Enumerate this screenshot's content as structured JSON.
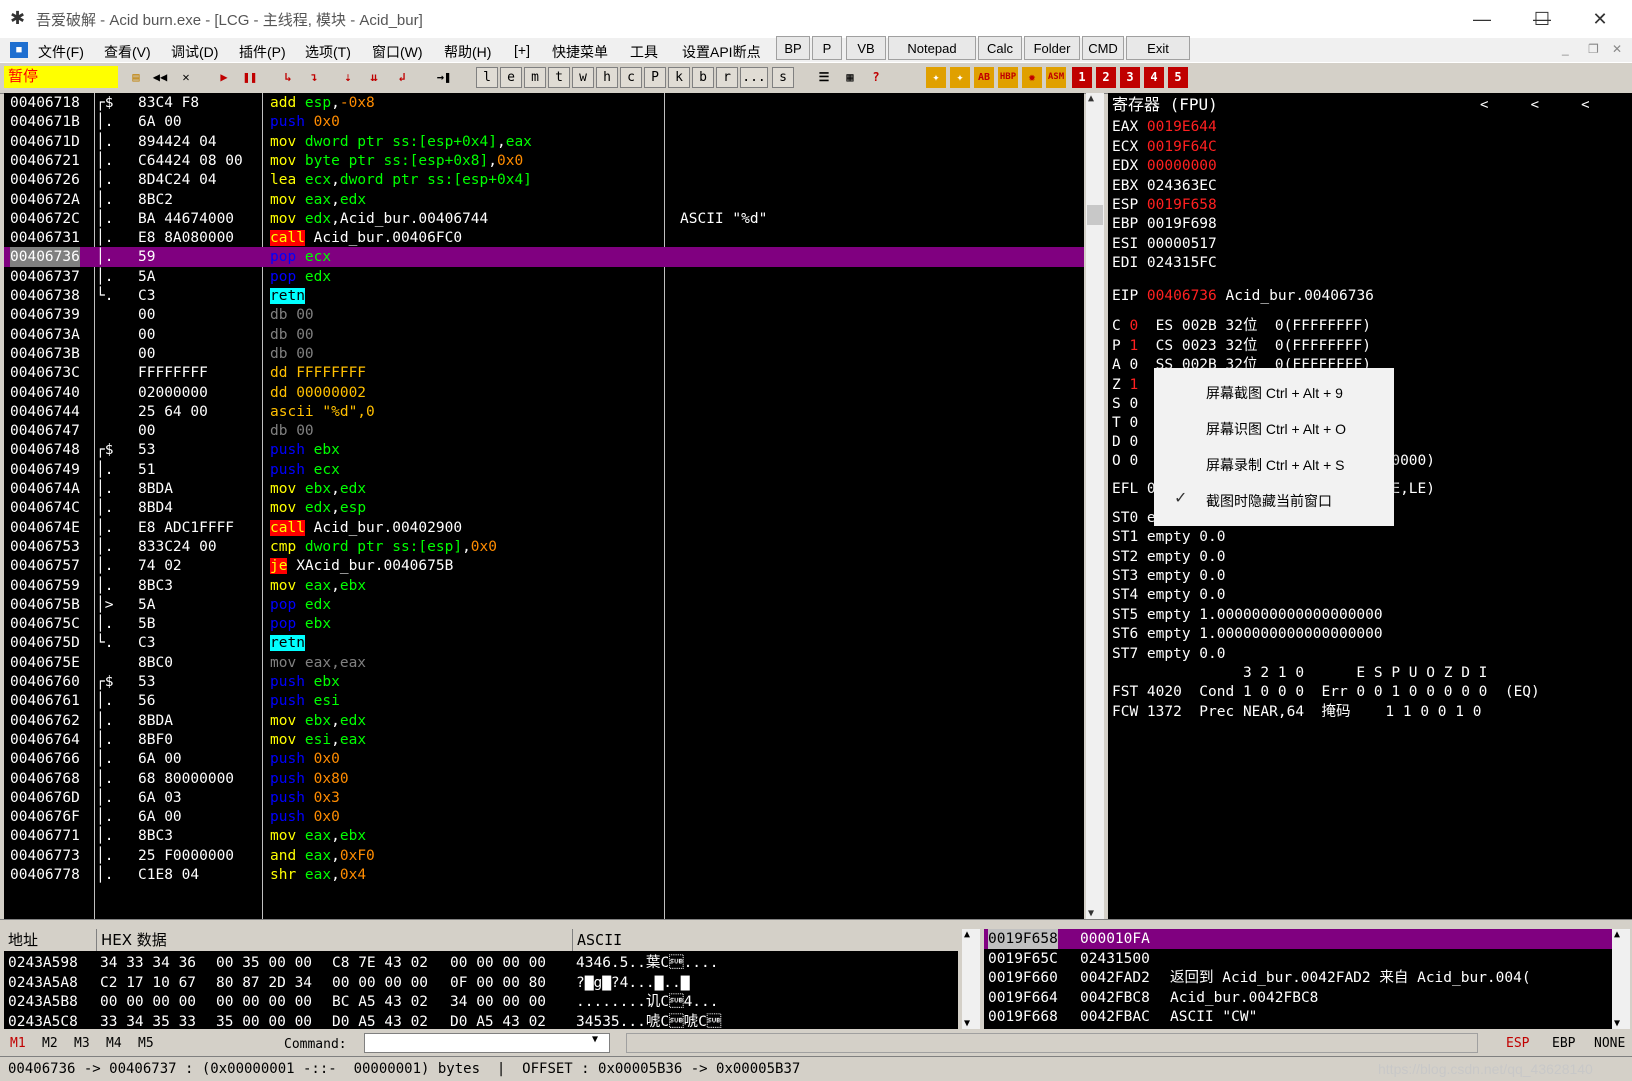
{
  "window": {
    "title": "吾爱破解 - Acid burn.exe - [LCG - 主线程, 模块 - Acid_bur]",
    "min": "—",
    "max": "☐",
    "close": "✕"
  },
  "menu": {
    "items": [
      "文件(F)",
      "查看(V)",
      "调试(D)",
      "插件(P)",
      "选项(T)",
      "窗口(W)",
      "帮助(H)",
      "[+]",
      "快捷菜单",
      "工具",
      "设置API断点"
    ],
    "buttons": [
      "BP",
      "P",
      "VB",
      "Notepad",
      "Calc",
      "Folder",
      "CMD",
      "Exit"
    ]
  },
  "toolbar": {
    "status": "暂停",
    "letters": [
      "l",
      "e",
      "m",
      "t",
      "w",
      "h",
      "c",
      "P",
      "k",
      "b",
      "r",
      "...",
      "s"
    ],
    "nums": [
      "1",
      "2",
      "3",
      "4",
      "5"
    ]
  },
  "cpu_rows": [
    {
      "a": "00406718",
      "b": "┌$",
      "h": "83C4 F8",
      "d": [
        [
          "op",
          "add "
        ],
        [
          "reg",
          "esp"
        ],
        [
          "wht",
          ","
        ],
        [
          "num",
          "-0x8"
        ]
      ],
      "c": ""
    },
    {
      "a": "0040671B",
      "b": "│.",
      "h": "6A 00",
      "d": [
        [
          "push",
          "push "
        ],
        [
          "num",
          "0x0"
        ]
      ],
      "c": ""
    },
    {
      "a": "0040671D",
      "b": "│.",
      "h": "894424 04",
      "d": [
        [
          "op",
          "mov "
        ],
        [
          "reg",
          "dword ptr ss:[esp+0x4]"
        ],
        [
          "wht",
          ","
        ],
        [
          "reg",
          "eax"
        ]
      ],
      "c": ""
    },
    {
      "a": "00406721",
      "b": "│.",
      "h": "C64424 08 00",
      "d": [
        [
          "op",
          "mov "
        ],
        [
          "reg",
          "byte ptr ss:[esp+0x8]"
        ],
        [
          "wht",
          ","
        ],
        [
          "num",
          "0x0"
        ]
      ],
      "c": ""
    },
    {
      "a": "00406726",
      "b": "│.",
      "h": "8D4C24 04",
      "d": [
        [
          "op",
          "lea "
        ],
        [
          "reg",
          "ecx"
        ],
        [
          "wht",
          ","
        ],
        [
          "reg",
          "dword ptr ss:[esp+0x4]"
        ]
      ],
      "c": ""
    },
    {
      "a": "0040672A",
      "b": "│.",
      "h": "8BC2",
      "d": [
        [
          "op",
          "mov "
        ],
        [
          "reg",
          "eax"
        ],
        [
          "wht",
          ","
        ],
        [
          "reg",
          "edx"
        ]
      ],
      "c": ""
    },
    {
      "a": "0040672C",
      "b": "│.",
      "h": "BA 44674000",
      "d": [
        [
          "op",
          "mov "
        ],
        [
          "reg",
          "edx"
        ],
        [
          "wht",
          ",Acid_bur.00406744"
        ]
      ],
      "c": "ASCII \"%d\""
    },
    {
      "a": "00406731",
      "b": "│.",
      "h": "E8 8A080000",
      "d": [
        [
          "call",
          "call"
        ],
        [
          "wht",
          " Acid_bur.00406FC0"
        ]
      ],
      "c": ""
    },
    {
      "a": "00406736",
      "b": "│.",
      "h": "59",
      "d": [
        [
          "push",
          "pop "
        ],
        [
          "reg",
          "ecx"
        ]
      ],
      "c": "",
      "sel": true
    },
    {
      "a": "00406737",
      "b": "│.",
      "h": "5A",
      "d": [
        [
          "push",
          "pop "
        ],
        [
          "reg",
          "edx"
        ]
      ],
      "c": ""
    },
    {
      "a": "00406738",
      "b": "└.",
      "h": "C3",
      "d": [
        [
          "retn",
          "retn"
        ]
      ],
      "c": ""
    },
    {
      "a": "00406739",
      "b": "",
      "h": "00",
      "d": [
        [
          "dim",
          "db 00"
        ]
      ],
      "c": ""
    },
    {
      "a": "0040673A",
      "b": "",
      "h": "00",
      "d": [
        [
          "dim",
          "db 00"
        ]
      ],
      "c": ""
    },
    {
      "a": "0040673B",
      "b": "",
      "h": "00",
      "d": [
        [
          "dim",
          "db 00"
        ]
      ],
      "c": ""
    },
    {
      "a": "0040673C",
      "b": "",
      "h": "FFFFFFFF",
      "d": [
        [
          "data",
          "dd FFFFFFFF"
        ]
      ],
      "c": ""
    },
    {
      "a": "00406740",
      "b": "",
      "h": "02000000",
      "d": [
        [
          "data",
          "dd 00000002"
        ]
      ],
      "c": ""
    },
    {
      "a": "00406744",
      "b": "",
      "h": "25 64 00",
      "d": [
        [
          "data",
          "ascii \"%d\",0"
        ]
      ],
      "c": ""
    },
    {
      "a": "00406747",
      "b": "",
      "h": "00",
      "d": [
        [
          "dim",
          "db 00"
        ]
      ],
      "c": ""
    },
    {
      "a": "00406748",
      "b": "┌$",
      "h": "53",
      "d": [
        [
          "push",
          "push "
        ],
        [
          "reg",
          "ebx"
        ]
      ],
      "c": ""
    },
    {
      "a": "00406749",
      "b": "│.",
      "h": "51",
      "d": [
        [
          "push",
          "push "
        ],
        [
          "reg",
          "ecx"
        ]
      ],
      "c": ""
    },
    {
      "a": "0040674A",
      "b": "│.",
      "h": "8BDA",
      "d": [
        [
          "op",
          "mov "
        ],
        [
          "reg",
          "ebx"
        ],
        [
          "wht",
          ","
        ],
        [
          "reg",
          "edx"
        ]
      ],
      "c": ""
    },
    {
      "a": "0040674C",
      "b": "│.",
      "h": "8BD4",
      "d": [
        [
          "op",
          "mov "
        ],
        [
          "reg",
          "edx"
        ],
        [
          "wht",
          ","
        ],
        [
          "reg",
          "esp"
        ]
      ],
      "c": ""
    },
    {
      "a": "0040674E",
      "b": "│.",
      "h": "E8 ADC1FFFF",
      "d": [
        [
          "call",
          "call"
        ],
        [
          "wht",
          " Acid_bur.00402900"
        ]
      ],
      "c": ""
    },
    {
      "a": "00406753",
      "b": "│.",
      "h": "833C24 00",
      "d": [
        [
          "op",
          "cmp "
        ],
        [
          "reg",
          "dword ptr ss:[esp]"
        ],
        [
          "wht",
          ","
        ],
        [
          "num",
          "0x0"
        ]
      ],
      "c": ""
    },
    {
      "a": "00406757",
      "b": "│.",
      "h": "74 02",
      "d": [
        [
          "call",
          "je"
        ],
        [
          "wht",
          " XAcid_bur.0040675B"
        ]
      ],
      "c": ""
    },
    {
      "a": "00406759",
      "b": "│.",
      "h": "8BC3",
      "d": [
        [
          "op",
          "mov "
        ],
        [
          "reg",
          "eax"
        ],
        [
          "wht",
          ","
        ],
        [
          "reg",
          "ebx"
        ]
      ],
      "c": ""
    },
    {
      "a": "0040675B",
      "b": "│>",
      "h": "5A",
      "d": [
        [
          "push",
          "pop "
        ],
        [
          "reg",
          "edx"
        ]
      ],
      "c": ""
    },
    {
      "a": "0040675C",
      "b": "│.",
      "h": "5B",
      "d": [
        [
          "push",
          "pop "
        ],
        [
          "reg",
          "ebx"
        ]
      ],
      "c": ""
    },
    {
      "a": "0040675D",
      "b": "└.",
      "h": "C3",
      "d": [
        [
          "retn",
          "retn"
        ]
      ],
      "c": ""
    },
    {
      "a": "0040675E",
      "b": "",
      "h": "8BC0",
      "d": [
        [
          "dim",
          "mov eax,eax"
        ]
      ],
      "c": ""
    },
    {
      "a": "00406760",
      "b": "┌$",
      "h": "53",
      "d": [
        [
          "push",
          "push "
        ],
        [
          "reg",
          "ebx"
        ]
      ],
      "c": ""
    },
    {
      "a": "00406761",
      "b": "│.",
      "h": "56",
      "d": [
        [
          "push",
          "push "
        ],
        [
          "reg",
          "esi"
        ]
      ],
      "c": ""
    },
    {
      "a": "00406762",
      "b": "│.",
      "h": "8BDA",
      "d": [
        [
          "op",
          "mov "
        ],
        [
          "reg",
          "ebx"
        ],
        [
          "wht",
          ","
        ],
        [
          "reg",
          "edx"
        ]
      ],
      "c": ""
    },
    {
      "a": "00406764",
      "b": "│.",
      "h": "8BF0",
      "d": [
        [
          "op",
          "mov "
        ],
        [
          "reg",
          "esi"
        ],
        [
          "wht",
          ","
        ],
        [
          "reg",
          "eax"
        ]
      ],
      "c": ""
    },
    {
      "a": "00406766",
      "b": "│.",
      "h": "6A 00",
      "d": [
        [
          "push",
          "push "
        ],
        [
          "num",
          "0x0"
        ]
      ],
      "c": ""
    },
    {
      "a": "00406768",
      "b": "│.",
      "h": "68 80000000",
      "d": [
        [
          "push",
          "push "
        ],
        [
          "num",
          "0x80"
        ]
      ],
      "c": ""
    },
    {
      "a": "0040676D",
      "b": "│.",
      "h": "6A 03",
      "d": [
        [
          "push",
          "push "
        ],
        [
          "num",
          "0x3"
        ]
      ],
      "c": ""
    },
    {
      "a": "0040676F",
      "b": "│.",
      "h": "6A 00",
      "d": [
        [
          "push",
          "push "
        ],
        [
          "num",
          "0x0"
        ]
      ],
      "c": ""
    },
    {
      "a": "00406771",
      "b": "│.",
      "h": "8BC3",
      "d": [
        [
          "op",
          "mov "
        ],
        [
          "reg",
          "eax"
        ],
        [
          "wht",
          ","
        ],
        [
          "reg",
          "ebx"
        ]
      ],
      "c": ""
    },
    {
      "a": "00406773",
      "b": "│.",
      "h": "25 F0000000",
      "d": [
        [
          "op",
          "and "
        ],
        [
          "reg",
          "eax"
        ],
        [
          "wht",
          ","
        ],
        [
          "num",
          "0xF0"
        ]
      ],
      "c": ""
    },
    {
      "a": "00406778",
      "b": "│.",
      "h": "C1E8 04",
      "d": [
        [
          "op",
          "shr "
        ],
        [
          "reg",
          "eax"
        ],
        [
          "wht",
          ","
        ],
        [
          "num",
          "0x4"
        ]
      ],
      "c": ""
    }
  ],
  "registers": {
    "header": "寄存器 (FPU)",
    "lines": [
      [
        [
          "w",
          "EAX "
        ],
        [
          "r",
          "0019E644"
        ]
      ],
      [
        [
          "w",
          "ECX "
        ],
        [
          "r",
          "0019F64C"
        ]
      ],
      [
        [
          "w",
          "EDX "
        ],
        [
          "r",
          "00000000"
        ]
      ],
      [
        [
          "w",
          "EBX 024363EC"
        ]
      ],
      [
        [
          "w",
          "ESP "
        ],
        [
          "r",
          "0019F658"
        ]
      ],
      [
        [
          "w",
          "EBP 0019F698"
        ]
      ],
      [
        [
          "w",
          "ESI 00000517"
        ]
      ],
      [
        [
          "w",
          "EDI 024315FC"
        ]
      ],
      [
        [
          "w",
          ""
        ]
      ],
      [
        [
          "w",
          "EIP "
        ],
        [
          "r",
          "00406736"
        ],
        [
          "w",
          " Acid_bur.00406736"
        ]
      ],
      [
        [
          "w",
          ""
        ]
      ],
      [
        [
          "w",
          "C "
        ],
        [
          "r",
          "0"
        ],
        [
          "w",
          "  ES 002B 32位  0(FFFFFFFF)"
        ]
      ],
      [
        [
          "w",
          "P "
        ],
        [
          "r",
          "1"
        ],
        [
          "w",
          "  CS 0023 32位  0(FFFFFFFF)"
        ]
      ],
      [
        [
          "w",
          "A 0  SS 002B 32位  0(FFFFFFFF)"
        ]
      ],
      [
        [
          "w",
          "Z "
        ],
        [
          "r",
          "1"
        ],
        [
          "w",
          "  DS 002B 32位  0(FFFFFFFF)"
        ]
      ],
      [
        [
          "w",
          "S 0  FS 0053 32位  216000(FFF)"
        ]
      ],
      [
        [
          "w",
          "T 0  GS 002B 32位  0(FFFFFFFF)"
        ]
      ],
      [
        [
          "w",
          "D 0"
        ]
      ],
      [
        [
          "w",
          "O 0  LastErr ERROR_SUCCESS (00000000)"
        ]
      ],
      [
        [
          "w",
          "EFL 00000246 (NO,NB,E,BE,NS,PE,GE,LE)"
        ]
      ],
      [
        [
          "w",
          "ST0 empty 0.0"
        ]
      ],
      [
        [
          "w",
          "ST1 empty 0.0"
        ]
      ],
      [
        [
          "w",
          "ST2 empty 0.0"
        ]
      ],
      [
        [
          "w",
          "ST3 empty 0.0"
        ]
      ],
      [
        [
          "w",
          "ST4 empty 0.0"
        ]
      ],
      [
        [
          "w",
          "ST5 empty 1.0000000000000000000"
        ]
      ],
      [
        [
          "w",
          "ST6 empty 1.0000000000000000000"
        ]
      ],
      [
        [
          "w",
          "ST7 empty 0.0"
        ]
      ],
      [
        [
          "w",
          "               3 2 1 0      E S P U O Z D I"
        ]
      ],
      [
        [
          "w",
          "FST 4020  Cond 1 0 0 0  Err 0 0 1 0 0 0 0 0  (EQ)"
        ]
      ],
      [
        [
          "w",
          "FCW 1372  Prec NEAR,64  掩码    1 1 0 0 1 0"
        ]
      ]
    ]
  },
  "context_menu": {
    "items": [
      "屏幕截图 Ctrl + Alt + 9",
      "屏幕识图 Ctrl + Alt + O",
      "屏幕录制 Ctrl + Alt + S",
      "截图时隐藏当前窗口"
    ],
    "check": "✓"
  },
  "dump": {
    "headers": [
      "地址",
      "HEX 数据",
      "ASCII"
    ],
    "rows": [
      [
        "0243A598",
        "34 33 34 36",
        "00 35 00 00",
        "C8 7E 43 02",
        "00 00 00 00",
        "4346.5..葉C\u001a...."
      ],
      [
        "0243A5A8",
        "C2 17 10 67",
        "80 87 2D 34",
        "00 00 00 00",
        "0F 00 00 80",
        "?▇g▇?4...▇..▇"
      ],
      [
        "0243A5B8",
        "00 00 00 00",
        "00 00 00 00",
        "BC A5 43 02",
        "34 00 00 00",
        "........讥C\u001a4..."
      ],
      [
        "0243A5C8",
        "33 34 35 33",
        "35 00 00 00",
        "D0 A5 43 02",
        "D0 A5 43 02",
        "34535...唬C\u001a唬C\u001a"
      ]
    ]
  },
  "stack": {
    "rows": [
      [
        "0019F658",
        "000010FA",
        ""
      ],
      [
        "0019F65C",
        "02431500",
        ""
      ],
      [
        "0019F660",
        "0042FAD2",
        "返回到 Acid_bur.0042FAD2 来自 Acid_bur.004("
      ],
      [
        "0019F664",
        "0042FBC8",
        "Acid_bur.0042FBC8"
      ],
      [
        "0019F668",
        "0042FBAC",
        "ASCII \"CW\""
      ]
    ]
  },
  "cmd": {
    "marks": [
      "M1",
      "M2",
      "M3",
      "M4",
      "M5"
    ],
    "label": "Command:",
    "value": "",
    "right": [
      "ESP",
      "EBP",
      "NONE"
    ]
  },
  "status": {
    "text": "00406736 -> 00406737 : (0x00000001 -::-  00000001) bytes  |  OFFSET : 0x00005B36 -> 0x00005B37",
    "watermark": "https://blog.csdn.net/qq_43628140"
  },
  "colors": {
    "accent_red": "#ff0000",
    "selection": "#800080",
    "call_bg": "#ff0000",
    "retn_bg": "#00ffff"
  }
}
